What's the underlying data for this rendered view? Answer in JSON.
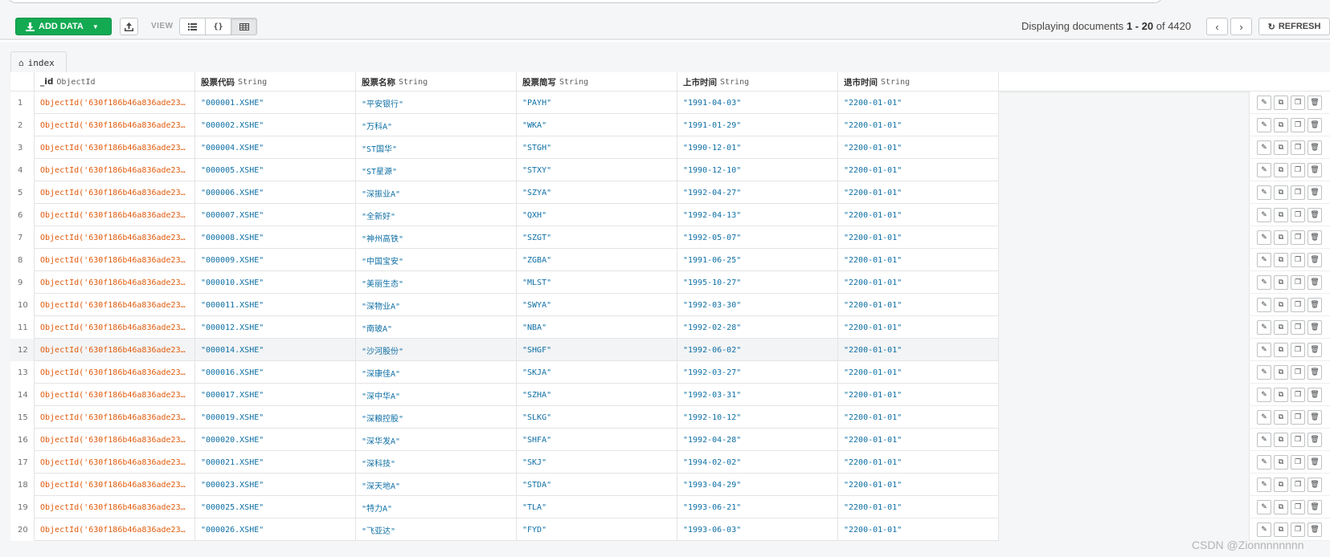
{
  "toolbar": {
    "add_data_label": "ADD DATA",
    "view_label": "VIEW",
    "displaying_prefix": "Displaying documents",
    "range_start": "1",
    "range_sep": "-",
    "range_end": "20",
    "of_label": "of",
    "total": "4420",
    "refresh_label": "REFRESH",
    "icons": {
      "add": "download-icon",
      "export": "export-icon",
      "list_view": "list-view-icon",
      "json_view": "json-view-icon",
      "table_view": "table-view-icon",
      "prev": "chevron-left-icon",
      "next": "chevron-right-icon",
      "refresh": "refresh-icon"
    }
  },
  "tab": {
    "label": "index",
    "icon": "home-icon"
  },
  "columns": [
    {
      "name": "_id",
      "type": "ObjectId"
    },
    {
      "name": "股票代码",
      "type": "String"
    },
    {
      "name": "股票名称",
      "type": "String"
    },
    {
      "name": "股票简写",
      "type": "String"
    },
    {
      "name": "上市时间",
      "type": "String"
    },
    {
      "name": "退市时间",
      "type": "String"
    }
  ],
  "rows": [
    {
      "n": "1",
      "id": "ObjectId('630f186b46a836ade23…",
      "code": "\"000001.XSHE\"",
      "name": "\"平安银行\"",
      "abbr": "\"PAYH\"",
      "list": "\"1991-04-03\"",
      "delist": "\"2200-01-01\""
    },
    {
      "n": "2",
      "id": "ObjectId('630f186b46a836ade23…",
      "code": "\"000002.XSHE\"",
      "name": "\"万科A\"",
      "abbr": "\"WKA\"",
      "list": "\"1991-01-29\"",
      "delist": "\"2200-01-01\""
    },
    {
      "n": "3",
      "id": "ObjectId('630f186b46a836ade23…",
      "code": "\"000004.XSHE\"",
      "name": "\"ST国华\"",
      "abbr": "\"STGH\"",
      "list": "\"1990-12-01\"",
      "delist": "\"2200-01-01\""
    },
    {
      "n": "4",
      "id": "ObjectId('630f186b46a836ade23…",
      "code": "\"000005.XSHE\"",
      "name": "\"ST星源\"",
      "abbr": "\"STXY\"",
      "list": "\"1990-12-10\"",
      "delist": "\"2200-01-01\""
    },
    {
      "n": "5",
      "id": "ObjectId('630f186b46a836ade23…",
      "code": "\"000006.XSHE\"",
      "name": "\"深振业A\"",
      "abbr": "\"SZYA\"",
      "list": "\"1992-04-27\"",
      "delist": "\"2200-01-01\""
    },
    {
      "n": "6",
      "id": "ObjectId('630f186b46a836ade23…",
      "code": "\"000007.XSHE\"",
      "name": "\"全新好\"",
      "abbr": "\"QXH\"",
      "list": "\"1992-04-13\"",
      "delist": "\"2200-01-01\""
    },
    {
      "n": "7",
      "id": "ObjectId('630f186b46a836ade23…",
      "code": "\"000008.XSHE\"",
      "name": "\"神州高铁\"",
      "abbr": "\"SZGT\"",
      "list": "\"1992-05-07\"",
      "delist": "\"2200-01-01\""
    },
    {
      "n": "8",
      "id": "ObjectId('630f186b46a836ade23…",
      "code": "\"000009.XSHE\"",
      "name": "\"中国宝安\"",
      "abbr": "\"ZGBA\"",
      "list": "\"1991-06-25\"",
      "delist": "\"2200-01-01\""
    },
    {
      "n": "9",
      "id": "ObjectId('630f186b46a836ade23…",
      "code": "\"000010.XSHE\"",
      "name": "\"美丽生态\"",
      "abbr": "\"MLST\"",
      "list": "\"1995-10-27\"",
      "delist": "\"2200-01-01\""
    },
    {
      "n": "10",
      "id": "ObjectId('630f186b46a836ade23…",
      "code": "\"000011.XSHE\"",
      "name": "\"深物业A\"",
      "abbr": "\"SWYA\"",
      "list": "\"1992-03-30\"",
      "delist": "\"2200-01-01\""
    },
    {
      "n": "11",
      "id": "ObjectId('630f186b46a836ade23…",
      "code": "\"000012.XSHE\"",
      "name": "\"南玻A\"",
      "abbr": "\"NBA\"",
      "list": "\"1992-02-28\"",
      "delist": "\"2200-01-01\""
    },
    {
      "n": "12",
      "id": "ObjectId('630f186b46a836ade23…",
      "code": "\"000014.XSHE\"",
      "name": "\"沙河股份\"",
      "abbr": "\"SHGF\"",
      "list": "\"1992-06-02\"",
      "delist": "\"2200-01-01\""
    },
    {
      "n": "13",
      "id": "ObjectId('630f186b46a836ade23…",
      "code": "\"000016.XSHE\"",
      "name": "\"深康佳A\"",
      "abbr": "\"SKJA\"",
      "list": "\"1992-03-27\"",
      "delist": "\"2200-01-01\""
    },
    {
      "n": "14",
      "id": "ObjectId('630f186b46a836ade23…",
      "code": "\"000017.XSHE\"",
      "name": "\"深中华A\"",
      "abbr": "\"SZHA\"",
      "list": "\"1992-03-31\"",
      "delist": "\"2200-01-01\""
    },
    {
      "n": "15",
      "id": "ObjectId('630f186b46a836ade23…",
      "code": "\"000019.XSHE\"",
      "name": "\"深粮控股\"",
      "abbr": "\"SLKG\"",
      "list": "\"1992-10-12\"",
      "delist": "\"2200-01-01\""
    },
    {
      "n": "16",
      "id": "ObjectId('630f186b46a836ade23…",
      "code": "\"000020.XSHE\"",
      "name": "\"深华发A\"",
      "abbr": "\"SHFA\"",
      "list": "\"1992-04-28\"",
      "delist": "\"2200-01-01\""
    },
    {
      "n": "17",
      "id": "ObjectId('630f186b46a836ade23…",
      "code": "\"000021.XSHE\"",
      "name": "\"深科技\"",
      "abbr": "\"SKJ\"",
      "list": "\"1994-02-02\"",
      "delist": "\"2200-01-01\""
    },
    {
      "n": "18",
      "id": "ObjectId('630f186b46a836ade23…",
      "code": "\"000023.XSHE\"",
      "name": "\"深天地A\"",
      "abbr": "\"STDA\"",
      "list": "\"1993-04-29\"",
      "delist": "\"2200-01-01\""
    },
    {
      "n": "19",
      "id": "ObjectId('630f186b46a836ade23…",
      "code": "\"000025.XSHE\"",
      "name": "\"特力A\"",
      "abbr": "\"TLA\"",
      "list": "\"1993-06-21\"",
      "delist": "\"2200-01-01\""
    },
    {
      "n": "20",
      "id": "ObjectId('630f186b46a836ade23…",
      "code": "\"000026.XSHE\"",
      "name": "\"飞亚达\"",
      "abbr": "\"FYD\"",
      "list": "\"1993-06-03\"",
      "delist": "\"2200-01-01\""
    }
  ],
  "row_actions": [
    "edit-icon",
    "copy-icon",
    "clone-icon",
    "delete-icon"
  ],
  "highlighted_row": 12,
  "watermark": "CSDN @Zionnnnnnnn",
  "colors": {
    "add_button": "#13aa52",
    "objectid": "#e05a0b",
    "string": "#0e6fa5"
  }
}
